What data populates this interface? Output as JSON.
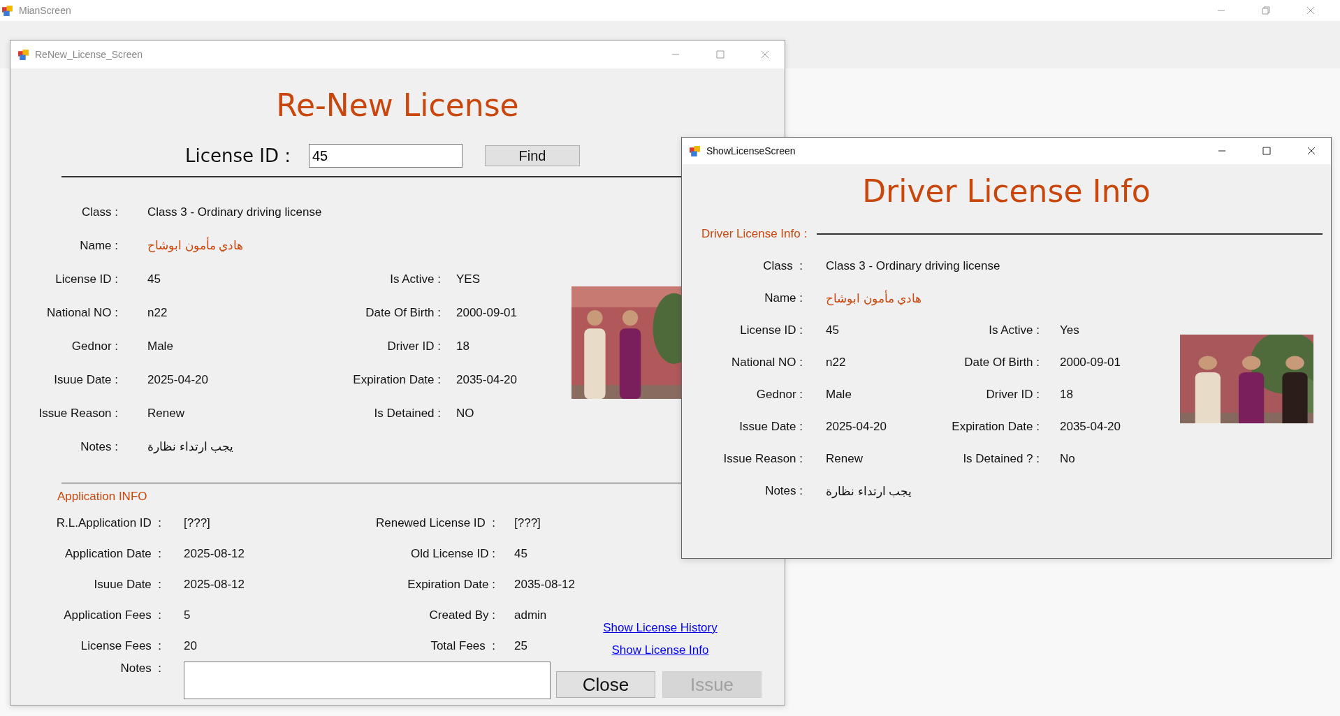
{
  "main_window": {
    "title": "MianScreen"
  },
  "renew_window": {
    "title": "ReNew_License_Screen",
    "heading": "Re-New License",
    "search": {
      "label": "License ID :",
      "value": "45",
      "button": "Find"
    },
    "license_rows": [
      {
        "fields": [
          {
            "label": "Class :",
            "value": "Class 3 - Ordinary driving license",
            "accent": false
          }
        ]
      },
      {
        "fields": [
          {
            "label": "Name :",
            "value": "هادي مأمون ابوشاح",
            "accent": true
          }
        ]
      },
      {
        "fields": [
          {
            "label": "License ID :",
            "value": "45",
            "accent": false
          },
          {
            "label": "Is Active :",
            "value": "YES",
            "accent": false
          }
        ]
      },
      {
        "fields": [
          {
            "label": "National NO :",
            "value": "n22",
            "accent": false
          },
          {
            "label": "Date Of Birth :",
            "value": "2000-09-01",
            "accent": false
          }
        ]
      },
      {
        "fields": [
          {
            "label": "Gednor :",
            "value": "Male",
            "accent": false
          },
          {
            "label": "Driver ID :",
            "value": "18",
            "accent": false
          }
        ]
      },
      {
        "fields": [
          {
            "label": "Isuue Date :",
            "value": "2025-04-20",
            "accent": false
          },
          {
            "label": "Expiration Date :",
            "value": "2035-04-20",
            "accent": false
          }
        ]
      },
      {
        "fields": [
          {
            "label": "Issue Reason :",
            "value": "Renew",
            "accent": false
          },
          {
            "label": "Is Detained :",
            "value": "NO",
            "accent": false
          }
        ]
      },
      {
        "fields": [
          {
            "label": "Notes :",
            "value": "يجب ارتداء نظارة",
            "accent": false
          }
        ]
      }
    ],
    "application": {
      "title": "Application INFO",
      "rows": [
        {
          "fields": [
            {
              "label": "R.L.Application ID  :",
              "value": "[???]"
            },
            {
              "label": "Renewed License ID  :",
              "value": "[???]"
            }
          ]
        },
        {
          "fields": [
            {
              "label": "Application Date  :",
              "value": "2025-08-12"
            },
            {
              "label": "Old License ID :",
              "value": "45"
            }
          ]
        },
        {
          "fields": [
            {
              "label": "Isuue Date  :",
              "value": "2025-08-12"
            },
            {
              "label": "Expiration Date :",
              "value": "2035-08-12"
            }
          ]
        },
        {
          "fields": [
            {
              "label": "Application Fees  :",
              "value": "5"
            },
            {
              "label": "Created By :",
              "value": "admin"
            }
          ]
        },
        {
          "fields": [
            {
              "label": "License Fees  :",
              "value": "20"
            },
            {
              "label": "Total Fees  :",
              "value": "25"
            }
          ]
        }
      ],
      "links": [
        {
          "label": "Show License History"
        },
        {
          "label": "Show License Info"
        }
      ],
      "notes_label": "Notes  :"
    },
    "buttons": [
      {
        "label": "Close",
        "disabled": false
      },
      {
        "label": "Issue",
        "disabled": true
      }
    ]
  },
  "show_window": {
    "title": "ShowLicenseScreen",
    "heading": "Driver License Info",
    "section": "Driver License Info :",
    "rows": [
      {
        "fields": [
          {
            "label": "Class  :",
            "value": "Class 3 - Ordinary driving license",
            "accent": false
          }
        ]
      },
      {
        "fields": [
          {
            "label": "Name :",
            "value": "هادي مأمون ابوشاح",
            "accent": true
          }
        ]
      },
      {
        "fields": [
          {
            "label": "License ID :",
            "value": "45",
            "accent": false
          },
          {
            "label": "Is Active :",
            "value": "Yes",
            "accent": false
          }
        ]
      },
      {
        "fields": [
          {
            "label": "National NO :",
            "value": "n22",
            "accent": false
          },
          {
            "label": "Date Of Birth :",
            "value": "2000-09-01",
            "accent": false
          }
        ]
      },
      {
        "fields": [
          {
            "label": "Gednor :",
            "value": "Male",
            "accent": false
          },
          {
            "label": "Driver ID :",
            "value": "18",
            "accent": false
          }
        ]
      },
      {
        "fields": [
          {
            "label": "Issue Date :",
            "value": "2025-04-20",
            "accent": false
          },
          {
            "label": "Expiration Date :",
            "value": "2035-04-20",
            "accent": false
          }
        ]
      },
      {
        "fields": [
          {
            "label": "Issue Reason :",
            "value": "Renew",
            "accent": false
          },
          {
            "label": "Is Detained ? :",
            "value": "No",
            "accent": false
          }
        ]
      },
      {
        "fields": [
          {
            "label": "Notes :",
            "value": "يجب ارتداء نظارة",
            "accent": false
          }
        ]
      }
    ]
  }
}
